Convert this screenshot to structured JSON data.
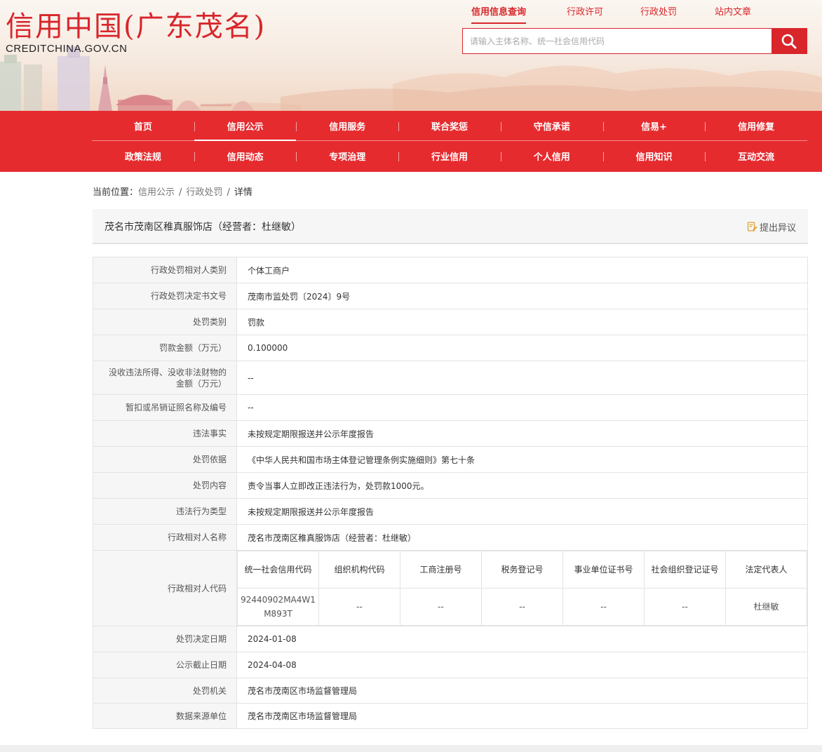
{
  "header": {
    "site_title": "信用中国(广东茂名)",
    "site_domain": "CREDITCHINA.GOV.CN",
    "top_tabs": [
      {
        "label": "信用信息查询"
      },
      {
        "label": "行政许可"
      },
      {
        "label": "行政处罚"
      },
      {
        "label": "站内文章"
      }
    ],
    "search": {
      "placeholder": "请输入主体名称、统一社会信用代码",
      "value": ""
    },
    "search_icon": "search-icon"
  },
  "nav": {
    "row1": [
      "首页",
      "信用公示",
      "信用服务",
      "联合奖惩",
      "守信承诺",
      "信易+",
      "信用修复"
    ],
    "row2": [
      "政策法规",
      "信用动态",
      "专项治理",
      "行业信用",
      "个人信用",
      "信用知识",
      "互动交流"
    ]
  },
  "breadcrumb": {
    "prefix": "当前位置：",
    "items": [
      "信用公示",
      "行政处罚",
      "详情"
    ],
    "separator": "/"
  },
  "entity": {
    "title": "茂名市茂南区稚真服饰店（经营者：杜继敏）",
    "objection_label": "提出异议",
    "objection_icon": "document-edit-icon"
  },
  "details": {
    "rows": [
      {
        "label": "行政处罚相对人类别",
        "value": "个体工商户"
      },
      {
        "label": "行政处罚决定书文号",
        "value": "茂南市监处罚〔2024〕9号"
      },
      {
        "label": "处罚类别",
        "value": "罚款"
      },
      {
        "label": "罚款金额（万元）",
        "value": "0.100000"
      },
      {
        "label": "没收违法所得、没收非法财物的金额（万元）",
        "value": "--"
      },
      {
        "label": "暂扣或吊销证照名称及编号",
        "value": "--"
      },
      {
        "label": "违法事实",
        "value": "未按规定期限报送并公示年度报告"
      },
      {
        "label": "处罚依据",
        "value": "《中华人民共和国市场主体登记管理条例实施细则》第七十条"
      },
      {
        "label": "处罚内容",
        "value": "责令当事人立即改正违法行为，处罚款1000元。"
      },
      {
        "label": "违法行为类型",
        "value": "未按规定期限报送并公示年度报告"
      },
      {
        "label": "行政相对人名称",
        "value": "茂名市茂南区稚真服饰店（经营者：杜继敏）"
      }
    ],
    "code_label": "行政相对人代码",
    "code_headers": [
      "统一社会信用代码",
      "组织机构代码",
      "工商注册号",
      "税务登记号",
      "事业单位证书号",
      "社会组织登记证号",
      "法定代表人"
    ],
    "code_values": [
      "92440902MA4W1M893T",
      "--",
      "--",
      "--",
      "--",
      "--",
      "杜继敏"
    ],
    "rows_after": [
      {
        "label": "处罚决定日期",
        "value": "2024-01-08"
      },
      {
        "label": "公示截止日期",
        "value": "2024-04-08"
      },
      {
        "label": "处罚机关",
        "value": "茂名市茂南区市场监督管理局"
      },
      {
        "label": "数据来源单位",
        "value": "茂名市茂南区市场监督管理局"
      }
    ]
  },
  "colors": {
    "brand_red": "#e62b2f",
    "title_red": "#d8262b"
  }
}
